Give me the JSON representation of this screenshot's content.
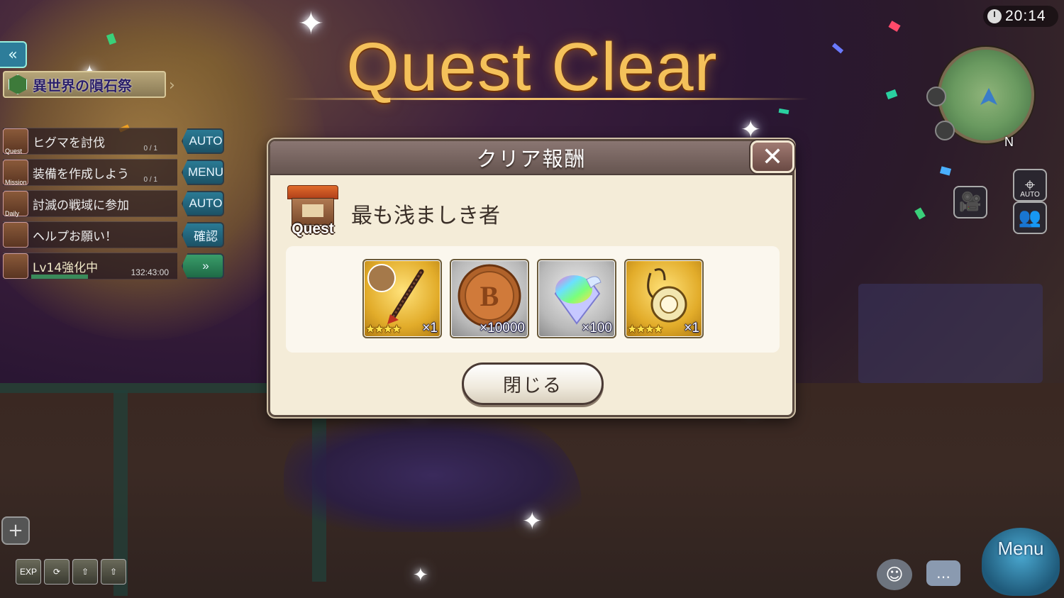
{
  "clock": {
    "time": "20:14",
    "icon": "clock-icon"
  },
  "banner": {
    "title": "Quest Clear"
  },
  "left_panel": {
    "back_icon": "double-chevron-left-icon",
    "event_title": "異世界の隕石祭",
    "missions": [
      {
        "category": "Quest",
        "label": "ヒグマを討伐",
        "progress": "0 / 1",
        "action": "AUTO"
      },
      {
        "category": "Mission",
        "label": "装備を作成しよう",
        "progress": "0 / 1",
        "action": "MENU"
      },
      {
        "category": "Daily",
        "label": "討滅の戦域に参加",
        "progress": "",
        "action": "AUTO"
      },
      {
        "category": "",
        "label": "ヘルプお願い！",
        "progress": "",
        "action": "確認"
      }
    ],
    "level_task": {
      "label": "Lv14強化中",
      "timer": "132:43:00",
      "action_icon": "fast-forward-icon",
      "progress_fraction": 0.4
    }
  },
  "minimap": {
    "compass": "N"
  },
  "side_buttons": {
    "auto_label": "AUTO"
  },
  "bottom_left": {
    "add_icon": "plus-icon",
    "boosts": [
      {
        "name": "exp-boost-icon",
        "label": "EXP"
      },
      {
        "name": "gold-boost-icon",
        "label": ""
      },
      {
        "name": "drop-boost-icon",
        "label": ""
      },
      {
        "name": "craft-boost-icon",
        "label": ""
      }
    ]
  },
  "bottom_right": {
    "menu_label": "Menu",
    "emote_icon": "emote-icon",
    "chat_icon": "chat-icon"
  },
  "dialog": {
    "title": "クリア報酬",
    "close_icon": "close-icon",
    "quest_tag": "Quest",
    "quest_name": "最も浅ましき者",
    "rewards": [
      {
        "name": "spear-reward",
        "stars": "★★★★",
        "quantity": "×1"
      },
      {
        "name": "coin-reward",
        "stars": "",
        "quantity": "×10000"
      },
      {
        "name": "crystal-reward",
        "stars": "",
        "quantity": "×100"
      },
      {
        "name": "accessory-reward",
        "stars": "★★★★",
        "quantity": "×1"
      }
    ],
    "close_button": "閉じる"
  }
}
